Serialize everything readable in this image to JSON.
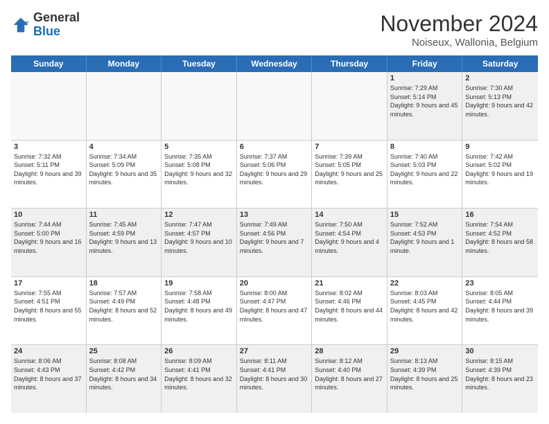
{
  "logo": {
    "general": "General",
    "blue": "Blue"
  },
  "title": "November 2024",
  "subtitle": "Noiseux, Wallonia, Belgium",
  "headers": [
    "Sunday",
    "Monday",
    "Tuesday",
    "Wednesday",
    "Thursday",
    "Friday",
    "Saturday"
  ],
  "rows": [
    [
      {
        "day": "",
        "info": ""
      },
      {
        "day": "",
        "info": ""
      },
      {
        "day": "",
        "info": ""
      },
      {
        "day": "",
        "info": ""
      },
      {
        "day": "",
        "info": ""
      },
      {
        "day": "1",
        "info": "Sunrise: 7:29 AM\nSunset: 5:14 PM\nDaylight: 9 hours and 45 minutes."
      },
      {
        "day": "2",
        "info": "Sunrise: 7:30 AM\nSunset: 5:13 PM\nDaylight: 9 hours and 42 minutes."
      }
    ],
    [
      {
        "day": "3",
        "info": "Sunrise: 7:32 AM\nSunset: 5:11 PM\nDaylight: 9 hours and 39 minutes."
      },
      {
        "day": "4",
        "info": "Sunrise: 7:34 AM\nSunset: 5:09 PM\nDaylight: 9 hours and 35 minutes."
      },
      {
        "day": "5",
        "info": "Sunrise: 7:35 AM\nSunset: 5:08 PM\nDaylight: 9 hours and 32 minutes."
      },
      {
        "day": "6",
        "info": "Sunrise: 7:37 AM\nSunset: 5:06 PM\nDaylight: 9 hours and 29 minutes."
      },
      {
        "day": "7",
        "info": "Sunrise: 7:39 AM\nSunset: 5:05 PM\nDaylight: 9 hours and 25 minutes."
      },
      {
        "day": "8",
        "info": "Sunrise: 7:40 AM\nSunset: 5:03 PM\nDaylight: 9 hours and 22 minutes."
      },
      {
        "day": "9",
        "info": "Sunrise: 7:42 AM\nSunset: 5:02 PM\nDaylight: 9 hours and 19 minutes."
      }
    ],
    [
      {
        "day": "10",
        "info": "Sunrise: 7:44 AM\nSunset: 5:00 PM\nDaylight: 9 hours and 16 minutes."
      },
      {
        "day": "11",
        "info": "Sunrise: 7:45 AM\nSunset: 4:59 PM\nDaylight: 9 hours and 13 minutes."
      },
      {
        "day": "12",
        "info": "Sunrise: 7:47 AM\nSunset: 4:57 PM\nDaylight: 9 hours and 10 minutes."
      },
      {
        "day": "13",
        "info": "Sunrise: 7:49 AM\nSunset: 4:56 PM\nDaylight: 9 hours and 7 minutes."
      },
      {
        "day": "14",
        "info": "Sunrise: 7:50 AM\nSunset: 4:54 PM\nDaylight: 9 hours and 4 minutes."
      },
      {
        "day": "15",
        "info": "Sunrise: 7:52 AM\nSunset: 4:53 PM\nDaylight: 9 hours and 1 minute."
      },
      {
        "day": "16",
        "info": "Sunrise: 7:54 AM\nSunset: 4:52 PM\nDaylight: 8 hours and 58 minutes."
      }
    ],
    [
      {
        "day": "17",
        "info": "Sunrise: 7:55 AM\nSunset: 4:51 PM\nDaylight: 8 hours and 55 minutes."
      },
      {
        "day": "18",
        "info": "Sunrise: 7:57 AM\nSunset: 4:49 PM\nDaylight: 8 hours and 52 minutes."
      },
      {
        "day": "19",
        "info": "Sunrise: 7:58 AM\nSunset: 4:48 PM\nDaylight: 8 hours and 49 minutes."
      },
      {
        "day": "20",
        "info": "Sunrise: 8:00 AM\nSunset: 4:47 PM\nDaylight: 8 hours and 47 minutes."
      },
      {
        "day": "21",
        "info": "Sunrise: 8:02 AM\nSunset: 4:46 PM\nDaylight: 8 hours and 44 minutes."
      },
      {
        "day": "22",
        "info": "Sunrise: 8:03 AM\nSunset: 4:45 PM\nDaylight: 8 hours and 42 minutes."
      },
      {
        "day": "23",
        "info": "Sunrise: 8:05 AM\nSunset: 4:44 PM\nDaylight: 8 hours and 39 minutes."
      }
    ],
    [
      {
        "day": "24",
        "info": "Sunrise: 8:06 AM\nSunset: 4:43 PM\nDaylight: 8 hours and 37 minutes."
      },
      {
        "day": "25",
        "info": "Sunrise: 8:08 AM\nSunset: 4:42 PM\nDaylight: 8 hours and 34 minutes."
      },
      {
        "day": "26",
        "info": "Sunrise: 8:09 AM\nSunset: 4:41 PM\nDaylight: 8 hours and 32 minutes."
      },
      {
        "day": "27",
        "info": "Sunrise: 8:11 AM\nSunset: 4:41 PM\nDaylight: 8 hours and 30 minutes."
      },
      {
        "day": "28",
        "info": "Sunrise: 8:12 AM\nSunset: 4:40 PM\nDaylight: 8 hours and 27 minutes."
      },
      {
        "day": "29",
        "info": "Sunrise: 8:13 AM\nSunset: 4:39 PM\nDaylight: 8 hours and 25 minutes."
      },
      {
        "day": "30",
        "info": "Sunrise: 8:15 AM\nSunset: 4:39 PM\nDaylight: 8 hours and 23 minutes."
      }
    ]
  ]
}
